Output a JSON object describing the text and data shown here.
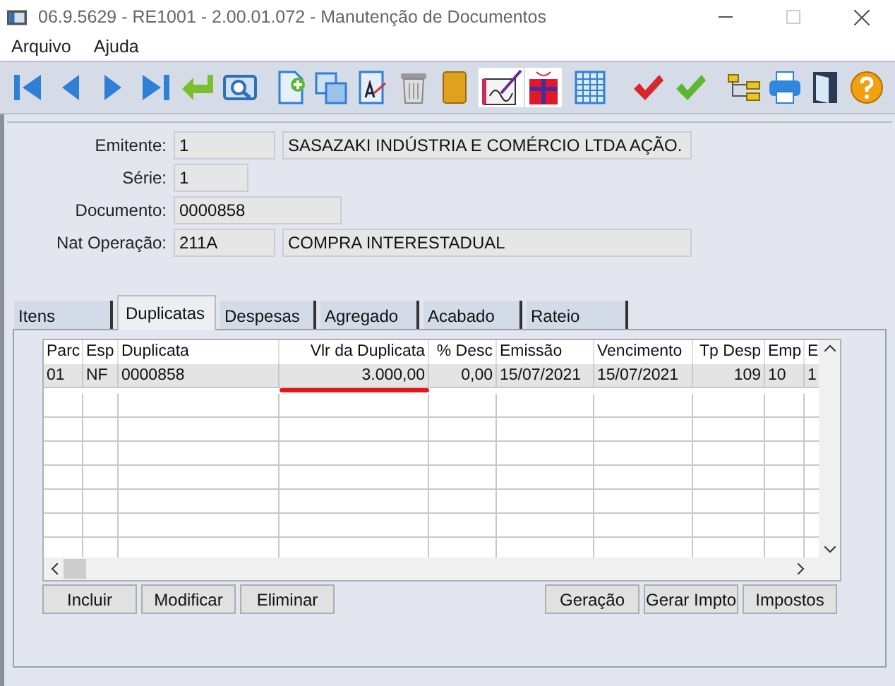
{
  "window": {
    "title": "06.9.5629 - RE1001 - 2.00.01.072 - Manutenção de Documentos"
  },
  "menu": [
    "Arquivo",
    "Ajuda"
  ],
  "header": {
    "fields": [
      {
        "label": "Emitente:",
        "values": [
          "1",
          "SASAZAKI INDÚSTRIA E COMÉRCIO LTDA AÇÃO."
        ]
      },
      {
        "label": "Série:",
        "values": [
          "1"
        ]
      },
      {
        "label": "Documento:",
        "values": [
          "0000858"
        ]
      },
      {
        "label": "Nat Operação:",
        "values": [
          "211A",
          "COMPRA INTERESTADUAL"
        ]
      }
    ]
  },
  "tabs": [
    {
      "label": "Itens",
      "selected": false
    },
    {
      "label": "Duplicatas",
      "selected": true
    },
    {
      "label": "Despesas",
      "selected": false
    },
    {
      "label": "Agregado",
      "selected": false
    },
    {
      "label": "Acabado",
      "selected": false
    },
    {
      "label": "Rateio",
      "selected": false
    }
  ],
  "table": {
    "columns": [
      {
        "label": "Parc",
        "numeric": false,
        "marked": false
      },
      {
        "label": "Esp",
        "numeric": false,
        "marked": false
      },
      {
        "label": "Duplicata",
        "numeric": false,
        "marked": false
      },
      {
        "label": "Vlr da Duplicata",
        "numeric": true,
        "marked": true
      },
      {
        "label": "% Desc",
        "numeric": true,
        "marked": false
      },
      {
        "label": "Emissão",
        "numeric": false,
        "marked": false
      },
      {
        "label": "Vencimento",
        "numeric": false,
        "marked": false
      },
      {
        "label": "Tp Desp",
        "numeric": true,
        "marked": false
      },
      {
        "label": "Emp",
        "numeric": false,
        "marked": false
      },
      {
        "label": "E",
        "numeric": false,
        "marked": false
      }
    ],
    "rows": [
      {
        "selected": true,
        "cells": [
          "01",
          "NF",
          "0000858",
          "3.000,00",
          "0,00",
          "15/07/2021",
          "15/07/2021",
          "109",
          "10",
          "1"
        ]
      }
    ]
  },
  "buttons_left": [
    "Incluir",
    "Modificar",
    "Eliminar"
  ],
  "buttons_right": [
    "Geração",
    "Gerar Impto",
    "Impostos"
  ]
}
